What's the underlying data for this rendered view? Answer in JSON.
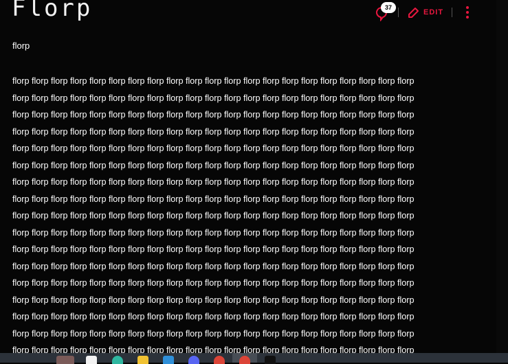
{
  "header": {
    "title": "Florp",
    "comment_count": "37",
    "edit_label": "EDIT"
  },
  "subtitle": "florp",
  "body_lines": [
    "florp florp florp florp florp florp florp florp florp florp florp florp florp florp florp florp florp florp florp florp florp",
    "florp florp florp florp florp florp florp florp florp florp florp florp florp florp florp florp florp florp florp florp florp",
    "florp florp florp florp florp florp florp florp florp florp florp florp florp florp florp florp florp florp florp florp florp",
    "florp florp florp florp florp florp florp florp florp florp florp florp florp florp florp florp florp florp florp florp florp",
    "florp florp florp florp florp florp florp florp florp florp florp florp florp florp florp florp florp florp florp florp florp",
    "florp florp florp florp florp florp florp florp florp florp florp florp florp florp florp florp florp florp florp florp florp",
    "florp florp florp florp florp florp florp florp florp florp florp florp florp florp florp florp florp florp florp florp florp",
    "florp florp florp florp florp florp florp florp florp florp florp florp florp florp florp florp florp florp florp florp florp",
    "florp florp florp florp florp florp florp florp florp florp florp florp florp florp florp florp florp florp florp florp florp",
    "florp florp florp florp florp florp florp florp florp florp florp florp florp florp florp florp florp florp florp florp florp",
    "florp florp florp florp florp florp florp florp florp florp florp florp florp florp florp florp florp florp florp florp florp",
    "florp florp florp florp florp florp florp florp florp florp florp florp florp florp florp florp florp florp florp florp florp",
    "florp florp florp florp florp florp florp florp florp florp florp florp florp florp florp florp florp florp florp florp florp",
    "florp florp florp florp florp florp florp florp florp florp florp florp florp florp florp florp florp florp florp florp florp",
    "florp florp florp florp florp florp florp florp florp florp florp florp florp florp florp florp florp florp florp florp florp",
    "florp florp florp florp florp florp florp florp florp florp florp florp florp florp florp florp florp florp florp florp florp",
    "florp florp florp florp florp florp florp florp florp florp florp florp florp florp florp florp florp florp florp florp florp"
  ],
  "taskbar": {
    "icons": [
      "castle-wallpaper-icon",
      "store-icon",
      "edge-icon",
      "file-explorer-icon",
      "photos-icon",
      "discord-icon",
      "chrome-icon",
      "chrome-active-icon",
      "app-icon"
    ]
  },
  "colors": {
    "accent": "#e8173f",
    "background": "#060606",
    "taskbar": "#2c323a"
  }
}
